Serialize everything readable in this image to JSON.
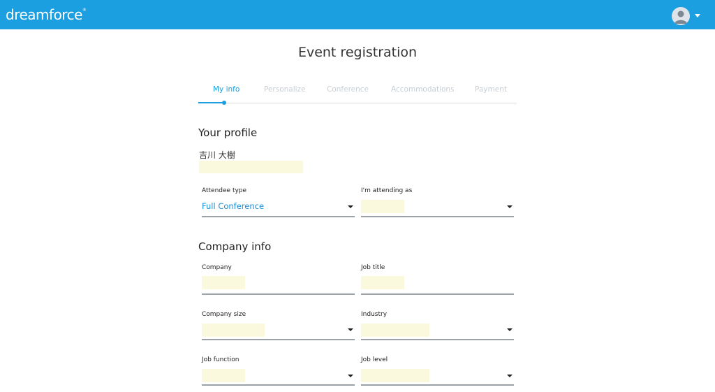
{
  "header": {
    "logo_text": "dreamforce",
    "logo_mark": "®",
    "avatar_icon": "user-avatar-icon",
    "menu_icon": "caret-down-icon",
    "brand_color": "#1b9fe0"
  },
  "page": {
    "title": "Event registration"
  },
  "steps": [
    {
      "label": "My info",
      "active": true
    },
    {
      "label": "Personalize",
      "active": false
    },
    {
      "label": "Conference",
      "active": false
    },
    {
      "label": "Accommodations",
      "active": false
    },
    {
      "label": "Payment",
      "active": false
    }
  ],
  "profile": {
    "heading": "Your profile",
    "name": "吉川 大樹",
    "attendee_type": {
      "label": "Attendee type",
      "value": "Full Conference"
    },
    "attending_as": {
      "label": "I'm attending as",
      "value": ""
    }
  },
  "company": {
    "heading": "Company info",
    "company": {
      "label": "Company",
      "value": ""
    },
    "job_title": {
      "label": "Job title",
      "value": ""
    },
    "company_size": {
      "label": "Company size",
      "value": ""
    },
    "industry": {
      "label": "Industry",
      "value": ""
    },
    "job_function": {
      "label": "Job function",
      "value": ""
    },
    "job_level": {
      "label": "Job level",
      "value": ""
    }
  }
}
